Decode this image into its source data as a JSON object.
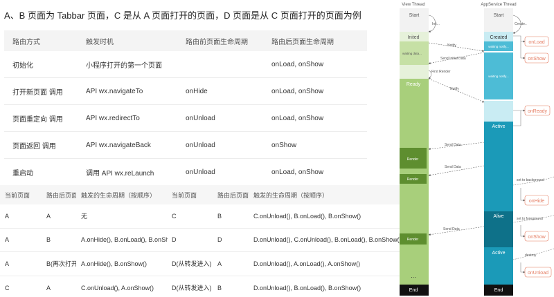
{
  "heading": "A、B 页面为 Tabbar 页面，C 是从 A 页面打开的页面，D 页面是从 C 页面打开的页面为例",
  "route_table": {
    "headers": [
      "路由方式",
      "触发时机",
      "路由前页面生命周期",
      "路由后页面生命周期"
    ],
    "rows": [
      [
        "初始化",
        "小程序打开的第一个页面",
        "",
        "onLoad, onShow"
      ],
      [
        "打开新页面 调用",
        "API wx.navigateTo",
        "onHide",
        "onLoad, onShow"
      ],
      [
        "页面重定向 调用",
        "API wx.redirectTo",
        "onUnload",
        "onLoad, onShow"
      ],
      [
        "页面返回 调用",
        "API wx.navigateBack",
        "onUnload",
        "onShow"
      ],
      [
        "重启动",
        "调用 API wx.reLaunch",
        "onUnload",
        "onLoad, onShow"
      ]
    ]
  },
  "lifecycle_table": {
    "headers": [
      "当前页面",
      "路由后页面",
      "触发的生命周期（按顺序）",
      "当前页面",
      "路由后页面",
      "触发的生命周期（按顺序）"
    ],
    "rows": [
      [
        "A",
        "A",
        "无",
        "C",
        "B",
        "C.onUnload(), B.onLoad(), B.onShow()"
      ],
      [
        "A",
        "B",
        "A.onHide(), B.onLoad(), B.onShow()",
        "D",
        "D",
        "D.onUnload(), C.onUnload(), B.onLoad(), B.onShow()"
      ],
      [
        "A",
        "B(再次打开)",
        "A.onHide(), B.onShow()",
        "D(从转发进入)",
        "A",
        "D.onUnload(), A.onLoad(), A.onShow()"
      ],
      [
        "C",
        "A",
        "C.onUnload(), A.onShow()",
        "D(从转发进入)",
        "B",
        "D.onUnload(), B.onLoad(), B.onShow()"
      ]
    ]
  },
  "diagram": {
    "view_thread_title": "View Thread",
    "appservice_thread_title": "AppService Thread",
    "view": {
      "start": "Start",
      "inited": "Inited",
      "waiting": "waiting data...",
      "ready": "Ready",
      "render": "Render",
      "dots": "...",
      "end": "End"
    },
    "app": {
      "start": "Start",
      "created": "Created",
      "waiting1": "waiting notify...",
      "waiting2": "waiting notify...",
      "active": "Active",
      "alive": "Alive",
      "end": "End"
    },
    "arrows": {
      "init": "Init...",
      "notify": "Notify",
      "send_initial_data": "Send Initial Data",
      "first_render": "First Render",
      "notify2": "Notify",
      "send_data": "Send Data",
      "create": "Create..",
      "to_background": "set to background",
      "to_foreground": "set to foreground",
      "destroy": "destroy"
    },
    "hooks": [
      "onLoad",
      "onShow",
      "onReady",
      "onHide",
      "onShow",
      "onUnload"
    ],
    "colors": {
      "view_green": "#a8cf7b",
      "view_light": "#e6f1da",
      "render_dark": "#5e8e2f",
      "app_blue": "#1b9ab8",
      "app_light": "#c9ecf3",
      "app_mid": "#4dbcd6",
      "app_alive": "#0e7189",
      "hook_red": "#e47a5f"
    }
  }
}
